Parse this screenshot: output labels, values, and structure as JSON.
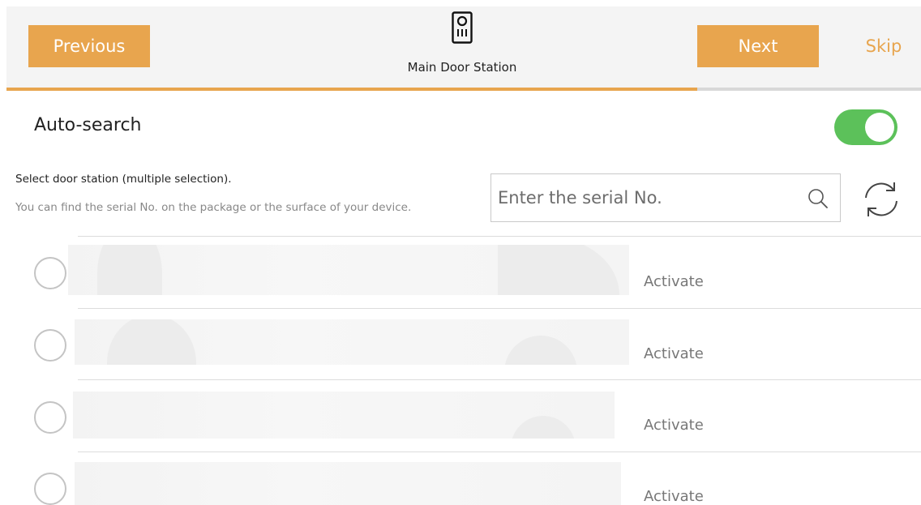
{
  "header": {
    "previous_label": "Previous",
    "next_label": "Next",
    "skip_label": "Skip",
    "title": "Main Door Station",
    "icon": "door-station-icon",
    "progress": 0.755
  },
  "autosearch": {
    "label": "Auto-search",
    "enabled": true
  },
  "instructions": {
    "line1": "Select door station (multiple selection).",
    "line2": "You can find the serial No. on the package or the surface of your device."
  },
  "search": {
    "placeholder": "Enter the serial No.",
    "value": ""
  },
  "devices": [
    {
      "action_label": "Activate",
      "selected": false
    },
    {
      "action_label": "Activate",
      "selected": false
    },
    {
      "action_label": "Activate",
      "selected": false
    },
    {
      "action_label": "Activate",
      "selected": false
    }
  ],
  "colors": {
    "accent": "#e8a54e",
    "toggle_on": "#5cc15a",
    "header_bg": "#f4f4f4"
  }
}
